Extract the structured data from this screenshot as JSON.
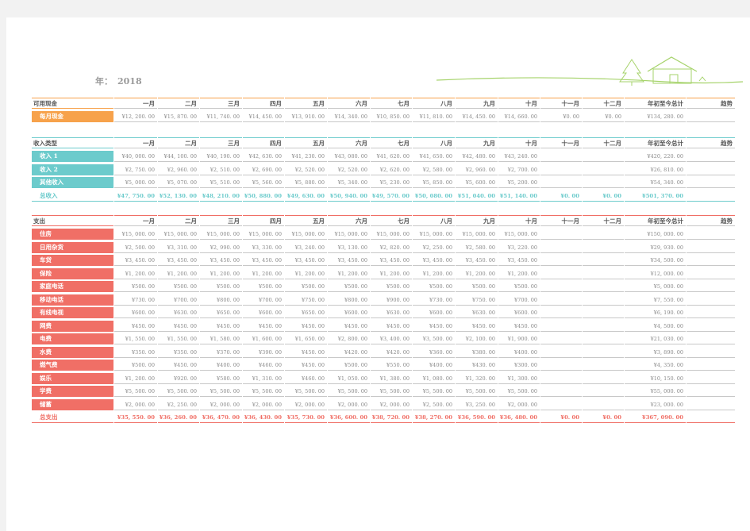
{
  "year_label": "年：",
  "year_value": "2018",
  "columns": [
    "一月",
    "二月",
    "三月",
    "四月",
    "五月",
    "六月",
    "七月",
    "八月",
    "九月",
    "十月",
    "十一月",
    "十二月",
    "年初至今总计",
    "趋势"
  ],
  "colors": {
    "cash": "#f7a24b",
    "income": "#6ccbcc",
    "expense": "#f06f66",
    "grey_line": "#c8c8c8"
  },
  "cash": {
    "header": "可用现金",
    "rows": [
      {
        "label": "每月现金",
        "values": [
          "¥12, 200. 00",
          "¥15, 870. 00",
          "¥11, 740. 00",
          "¥14, 450. 00",
          "¥13, 910. 00",
          "¥14, 340. 00",
          "¥10, 850. 00",
          "¥11, 810. 00",
          "¥14, 450. 00",
          "¥14, 660. 00",
          "¥0. 00",
          "¥0. 00",
          "¥134, 280. 00",
          ""
        ]
      }
    ]
  },
  "income": {
    "header": "收入类型",
    "rows": [
      {
        "label": "收入 1",
        "values": [
          "¥40, 000. 00",
          "¥44, 100. 00",
          "¥40, 190. 00",
          "¥42, 630. 00",
          "¥41, 230. 00",
          "¥43, 080. 00",
          "¥41, 620. 00",
          "¥41, 650. 00",
          "¥42, 480. 00",
          "¥43, 240. 00",
          "",
          "",
          "¥420, 220. 00",
          ""
        ]
      },
      {
        "label": "收入 2",
        "values": [
          "¥2, 750. 00",
          "¥2, 960. 00",
          "¥2, 510. 00",
          "¥2, 690. 00",
          "¥2, 520. 00",
          "¥2, 520. 00",
          "¥2, 620. 00",
          "¥2, 580. 00",
          "¥2, 960. 00",
          "¥2, 700. 00",
          "",
          "",
          "¥26, 810. 00",
          ""
        ]
      },
      {
        "label": "其他收入",
        "values": [
          "¥5, 000. 00",
          "¥5, 070. 00",
          "¥5, 510. 00",
          "¥5, 560. 00",
          "¥5, 880. 00",
          "¥5, 340. 00",
          "¥5, 230. 00",
          "¥5, 850. 00",
          "¥5, 600. 00",
          "¥5, 200. 00",
          "",
          "",
          "¥54, 340. 00",
          ""
        ]
      }
    ],
    "total": {
      "label": "总收入",
      "values": [
        "¥47, 750. 00",
        "¥52, 130. 00",
        "¥48, 210. 00",
        "¥50, 880. 00",
        "¥49, 630. 00",
        "¥50, 940. 00",
        "¥49, 570. 00",
        "¥50, 080. 00",
        "¥51, 040. 00",
        "¥51, 140. 00",
        "¥0. 00",
        "¥0. 00",
        "¥501, 370. 00",
        ""
      ]
    }
  },
  "expense": {
    "header": "支出",
    "rows": [
      {
        "label": "住房",
        "values": [
          "¥15, 000. 00",
          "¥15, 000. 00",
          "¥15, 000. 00",
          "¥15, 000. 00",
          "¥15, 000. 00",
          "¥15, 000. 00",
          "¥15, 000. 00",
          "¥15, 000. 00",
          "¥15, 000. 00",
          "¥15, 000. 00",
          "",
          "",
          "¥150, 000. 00",
          ""
        ]
      },
      {
        "label": "日用杂货",
        "values": [
          "¥2, 500. 00",
          "¥3, 310. 00",
          "¥2, 990. 00",
          "¥3, 330. 00",
          "¥3, 240. 00",
          "¥3, 130. 00",
          "¥2, 820. 00",
          "¥2, 250. 00",
          "¥2, 580. 00",
          "¥3, 220. 00",
          "",
          "",
          "¥29, 930. 00",
          ""
        ]
      },
      {
        "label": "车贷",
        "values": [
          "¥3, 450. 00",
          "¥3, 450. 00",
          "¥3, 450. 00",
          "¥3, 450. 00",
          "¥3, 450. 00",
          "¥3, 450. 00",
          "¥3, 450. 00",
          "¥3, 450. 00",
          "¥3, 450. 00",
          "¥3, 450. 00",
          "",
          "",
          "¥34, 500. 00",
          ""
        ]
      },
      {
        "label": "保险",
        "values": [
          "¥1, 200. 00",
          "¥1, 200. 00",
          "¥1, 200. 00",
          "¥1, 200. 00",
          "¥1, 200. 00",
          "¥1, 200. 00",
          "¥1, 200. 00",
          "¥1, 200. 00",
          "¥1, 200. 00",
          "¥1, 200. 00",
          "",
          "",
          "¥12, 000. 00",
          ""
        ]
      },
      {
        "label": "家庭电话",
        "values": [
          "¥500. 00",
          "¥500. 00",
          "¥500. 00",
          "¥500. 00",
          "¥500. 00",
          "¥500. 00",
          "¥500. 00",
          "¥500. 00",
          "¥500. 00",
          "¥500. 00",
          "",
          "",
          "¥5, 000. 00",
          ""
        ]
      },
      {
        "label": "移动电话",
        "values": [
          "¥730. 00",
          "¥700. 00",
          "¥800. 00",
          "¥700. 00",
          "¥750. 00",
          "¥800. 00",
          "¥900. 00",
          "¥730. 00",
          "¥750. 00",
          "¥700. 00",
          "",
          "",
          "¥7, 550. 00",
          ""
        ]
      },
      {
        "label": "有线电视",
        "values": [
          "¥600. 00",
          "¥630. 00",
          "¥650. 00",
          "¥600. 00",
          "¥650. 00",
          "¥600. 00",
          "¥630. 00",
          "¥600. 00",
          "¥630. 00",
          "¥600. 00",
          "",
          "",
          "¥6, 190. 00",
          ""
        ]
      },
      {
        "label": "网费",
        "values": [
          "¥450. 00",
          "¥450. 00",
          "¥450. 00",
          "¥450. 00",
          "¥450. 00",
          "¥450. 00",
          "¥450. 00",
          "¥450. 00",
          "¥450. 00",
          "¥450. 00",
          "",
          "",
          "¥4, 500. 00",
          ""
        ]
      },
      {
        "label": "电费",
        "values": [
          "¥1, 550. 00",
          "¥1, 550. 00",
          "¥1, 580. 00",
          "¥1, 600. 00",
          "¥1, 650. 00",
          "¥2, 800. 00",
          "¥3, 400. 00",
          "¥3, 500. 00",
          "¥2, 100. 00",
          "¥1, 900. 00",
          "",
          "",
          "¥21, 030. 00",
          ""
        ]
      },
      {
        "label": "水费",
        "values": [
          "¥350. 00",
          "¥350. 00",
          "¥370. 00",
          "¥390. 00",
          "¥450. 00",
          "¥420. 00",
          "¥420. 00",
          "¥360. 00",
          "¥380. 00",
          "¥400. 00",
          "",
          "",
          "¥3, 890. 00",
          ""
        ]
      },
      {
        "label": "燃气费",
        "values": [
          "¥500. 00",
          "¥450. 00",
          "¥400. 00",
          "¥460. 00",
          "¥450. 00",
          "¥500. 00",
          "¥550. 00",
          "¥400. 00",
          "¥430. 00",
          "¥300. 00",
          "",
          "",
          "¥4, 350. 00",
          ""
        ]
      },
      {
        "label": "娱乐",
        "values": [
          "¥1, 200. 00",
          "¥920. 00",
          "¥580. 00",
          "¥1, 310. 00",
          "¥460. 00",
          "¥1, 050. 00",
          "¥1, 380. 00",
          "¥1, 080. 00",
          "¥1, 320. 00",
          "¥1, 300. 00",
          "",
          "",
          "¥10, 150. 00",
          ""
        ]
      },
      {
        "label": "学费",
        "values": [
          "¥5, 500. 00",
          "¥5, 500. 00",
          "¥5, 500. 00",
          "¥5, 500. 00",
          "¥5, 500. 00",
          "¥5, 500. 00",
          "¥5, 500. 00",
          "¥5, 500. 00",
          "¥5, 500. 00",
          "¥5, 500. 00",
          "",
          "",
          "¥55, 000. 00",
          ""
        ]
      },
      {
        "label": "储蓄",
        "values": [
          "¥2, 000. 00",
          "¥2, 250. 00",
          "¥2, 000. 00",
          "¥2, 000. 00",
          "¥2, 000. 00",
          "¥2, 000. 00",
          "¥2, 000. 00",
          "¥2, 500. 00",
          "¥3, 250. 00",
          "¥2, 000. 00",
          "",
          "",
          "¥23, 000. 00",
          ""
        ]
      }
    ],
    "total": {
      "label": "总支出",
      "values": [
        "¥35, 550. 00",
        "¥36, 260. 00",
        "¥36, 470. 00",
        "¥36, 430. 00",
        "¥35, 730. 00",
        "¥36, 600. 00",
        "¥38, 720. 00",
        "¥38, 270. 00",
        "¥36, 590. 00",
        "¥36, 480. 00",
        "¥0. 00",
        "¥0. 00",
        "¥367, 090. 00",
        ""
      ]
    }
  }
}
